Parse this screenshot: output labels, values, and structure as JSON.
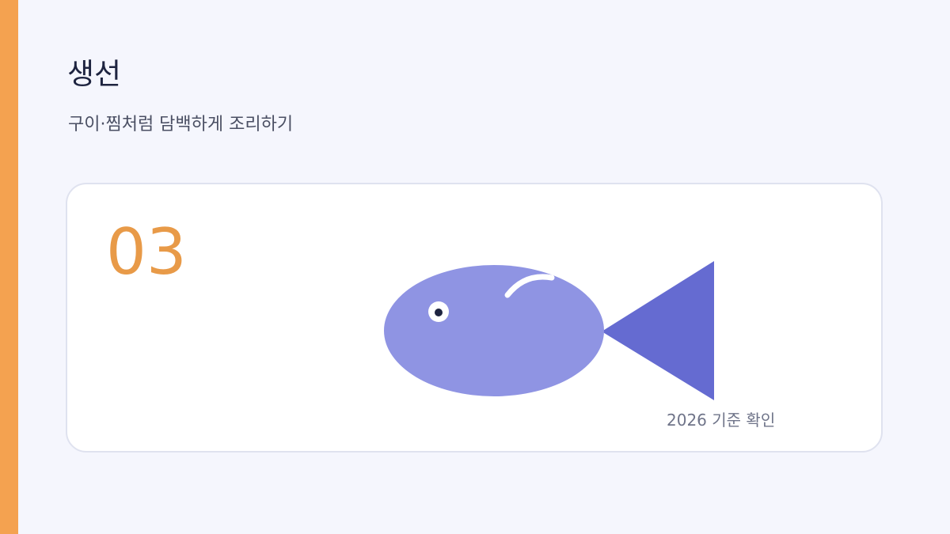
{
  "slide": {
    "title": "생선",
    "subtitle": "구이·찜처럼 담백하게 조리하기",
    "card": {
      "number": "03",
      "illustration_icon": "fish-icon",
      "caption": "2026 기준 확인"
    }
  },
  "colors": {
    "accent": "#f4a250",
    "number": "#e89a48",
    "fish_body": "#8f94e3",
    "fish_tail": "#656bd1",
    "background": "#f5f6fd"
  }
}
